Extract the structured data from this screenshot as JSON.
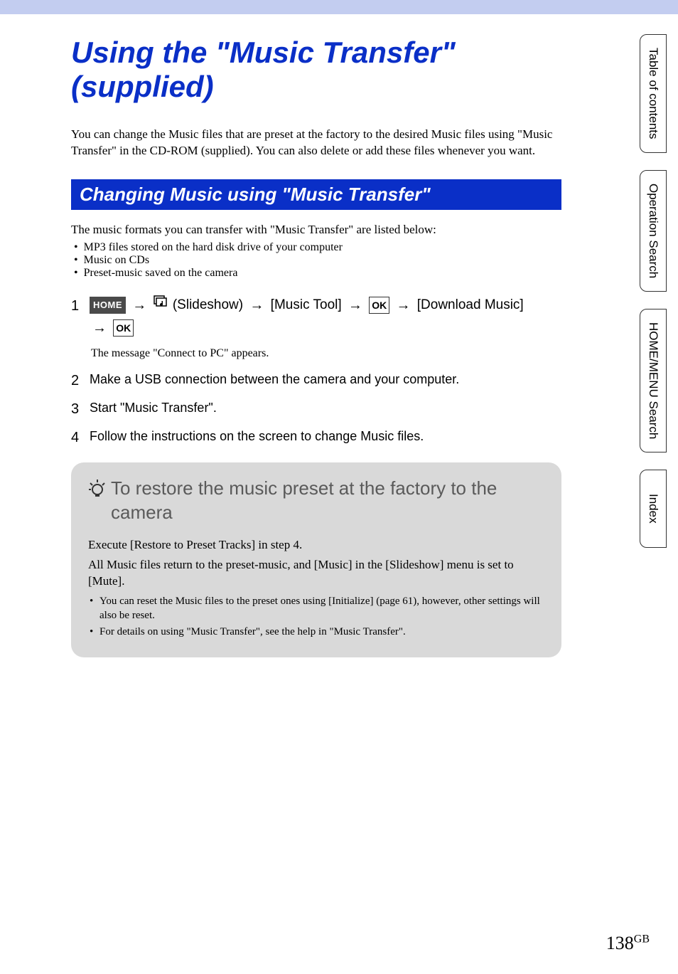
{
  "title": "Using the \"Music Transfer\" (supplied)",
  "intro": "You can change the Music files that are preset at the factory to the desired Music files using \"Music Transfer\" in the CD-ROM (supplied). You can also delete or add these files whenever you want.",
  "section_heading": "Changing Music using \"Music Transfer\"",
  "formats_intro": "The music formats you can transfer with \"Music Transfer\" are listed below:",
  "formats": [
    "MP3 files stored on the hard disk drive of your computer",
    "Music on CDs",
    "Preset-music saved on the camera"
  ],
  "steps": {
    "s1": {
      "num": "1",
      "home_label": "HOME",
      "slideshow_label": "(Slideshow)",
      "music_tool": "[Music Tool]",
      "ok_label": "OK",
      "download_music": "[Download Music]",
      "ok_label2": "OK",
      "message": "The message \"Connect to PC\" appears."
    },
    "s2": {
      "num": "2",
      "text": "Make a USB connection between the camera and your computer."
    },
    "s3": {
      "num": "3",
      "text": "Start \"Music Transfer\"."
    },
    "s4": {
      "num": "4",
      "text": "Follow the instructions on the screen to change Music files."
    }
  },
  "tip": {
    "title": "To restore the music preset at the factory to the camera",
    "p1": "Execute [Restore to Preset Tracks] in step 4.",
    "p2": "All Music files return to the preset-music, and [Music] in the [Slideshow] menu is set to [Mute].",
    "bullets": [
      "You can reset the Music files to the preset ones using [Initialize] (page 61), however, other settings will also be reset.",
      "For details on using \"Music Transfer\", see the help in \"Music Transfer\"."
    ]
  },
  "tabs": {
    "toc": "Table of contents",
    "op": "Operation Search",
    "home": "HOME/MENU Search",
    "index": "Index"
  },
  "page": {
    "num": "138",
    "suffix": "GB"
  },
  "arrow_glyph": "→"
}
